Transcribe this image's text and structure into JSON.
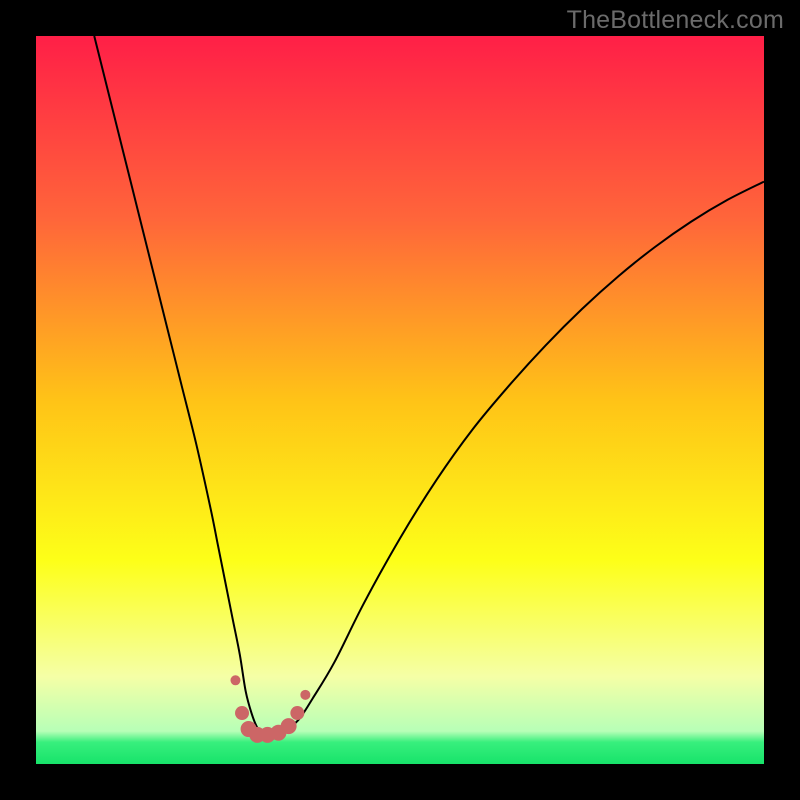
{
  "watermark": "TheBottleneck.com",
  "chart_data": {
    "type": "line",
    "title": "",
    "xlabel": "",
    "ylabel": "",
    "xlim": [
      0,
      100
    ],
    "ylim": [
      0,
      100
    ],
    "grid": false,
    "legend": false,
    "background_gradient": {
      "stops": [
        {
          "offset": 0.0,
          "color": "#ff1f47"
        },
        {
          "offset": 0.25,
          "color": "#ff653a"
        },
        {
          "offset": 0.5,
          "color": "#ffc317"
        },
        {
          "offset": 0.72,
          "color": "#fdff18"
        },
        {
          "offset": 0.88,
          "color": "#f5ffa6"
        },
        {
          "offset": 0.955,
          "color": "#b7ffb7"
        },
        {
          "offset": 0.97,
          "color": "#38ef7d"
        },
        {
          "offset": 1.0,
          "color": "#17e36a"
        }
      ]
    },
    "series": [
      {
        "name": "curve",
        "color": "#000000",
        "stroke_width": 2,
        "x": [
          8,
          10,
          12,
          14,
          16,
          18,
          20,
          22,
          24,
          25,
          26,
          27,
          28,
          28.8,
          29.6,
          30.4,
          31.4,
          32.5,
          34,
          36,
          38,
          41,
          45,
          50,
          55,
          60,
          65,
          70,
          75,
          80,
          85,
          90,
          95,
          100
        ],
        "y": [
          100,
          92,
          84,
          76,
          68,
          60,
          52,
          44,
          35,
          30,
          25,
          20,
          15,
          10,
          7,
          5,
          4,
          4,
          4.5,
          6,
          9,
          14,
          22,
          31,
          39,
          46,
          52,
          57.5,
          62.5,
          67,
          71,
          74.5,
          77.5,
          80
        ]
      }
    ],
    "markers": {
      "color": "#cc6666",
      "points": [
        {
          "x": 27.4,
          "y": 11.5,
          "r": 5
        },
        {
          "x": 28.3,
          "y": 7.0,
          "r": 7
        },
        {
          "x": 29.2,
          "y": 4.8,
          "r": 8
        },
        {
          "x": 30.4,
          "y": 4.0,
          "r": 8
        },
        {
          "x": 31.8,
          "y": 4.0,
          "r": 8
        },
        {
          "x": 33.3,
          "y": 4.3,
          "r": 8
        },
        {
          "x": 34.7,
          "y": 5.2,
          "r": 8
        },
        {
          "x": 35.9,
          "y": 7.0,
          "r": 7
        },
        {
          "x": 37.0,
          "y": 9.5,
          "r": 5
        }
      ]
    }
  }
}
